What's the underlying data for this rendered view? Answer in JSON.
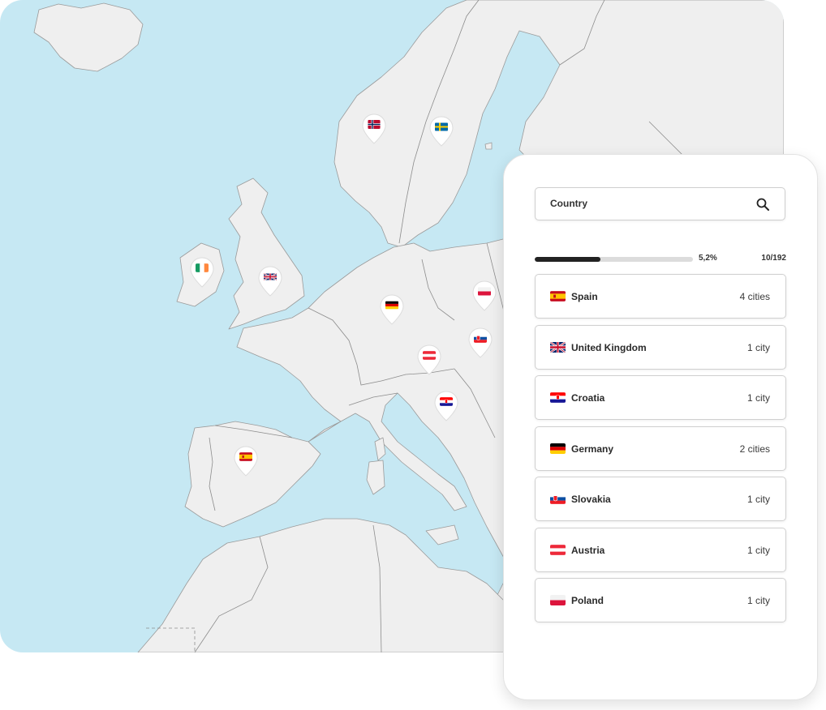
{
  "map": {
    "sea_color": "#c6e8f3",
    "land_color": "#efefef",
    "border_color": "#8a8a8a",
    "markers": [
      {
        "country": "Norway",
        "flag_icon": "norway-flag-icon"
      },
      {
        "country": "Sweden",
        "flag_icon": "sweden-flag-icon"
      },
      {
        "country": "Ireland",
        "flag_icon": "ireland-flag-icon"
      },
      {
        "country": "United Kingdom",
        "flag_icon": "uk-flag-icon"
      },
      {
        "country": "Germany",
        "flag_icon": "germany-flag-icon"
      },
      {
        "country": "Poland",
        "flag_icon": "poland-flag-icon"
      },
      {
        "country": "Slovakia",
        "flag_icon": "slovakia-flag-icon"
      },
      {
        "country": "Austria",
        "flag_icon": "austria-flag-icon"
      },
      {
        "country": "Croatia",
        "flag_icon": "croatia-flag-icon"
      },
      {
        "country": "Spain",
        "flag_icon": "spain-flag-icon"
      }
    ]
  },
  "panel": {
    "search": {
      "placeholder": "Country",
      "icon": "search-icon"
    },
    "progress": {
      "percent_label": "5,2%",
      "fraction": 0.052,
      "count_label": "10/192"
    },
    "countries": [
      {
        "name": "Spain",
        "cities": "4 cities",
        "flag_icon": "spain-flag-icon"
      },
      {
        "name": "United Kingdom",
        "cities": "1 city",
        "flag_icon": "uk-flag-icon"
      },
      {
        "name": "Croatia",
        "cities": "1 city",
        "flag_icon": "croatia-flag-icon"
      },
      {
        "name": "Germany",
        "cities": "2 cities",
        "flag_icon": "germany-flag-icon"
      },
      {
        "name": "Slovakia",
        "cities": "1 city",
        "flag_icon": "slovakia-flag-icon"
      },
      {
        "name": "Austria",
        "cities": "1 city",
        "flag_icon": "austria-flag-icon"
      },
      {
        "name": "Poland",
        "cities": "1 city",
        "flag_icon": "poland-flag-icon"
      }
    ]
  }
}
